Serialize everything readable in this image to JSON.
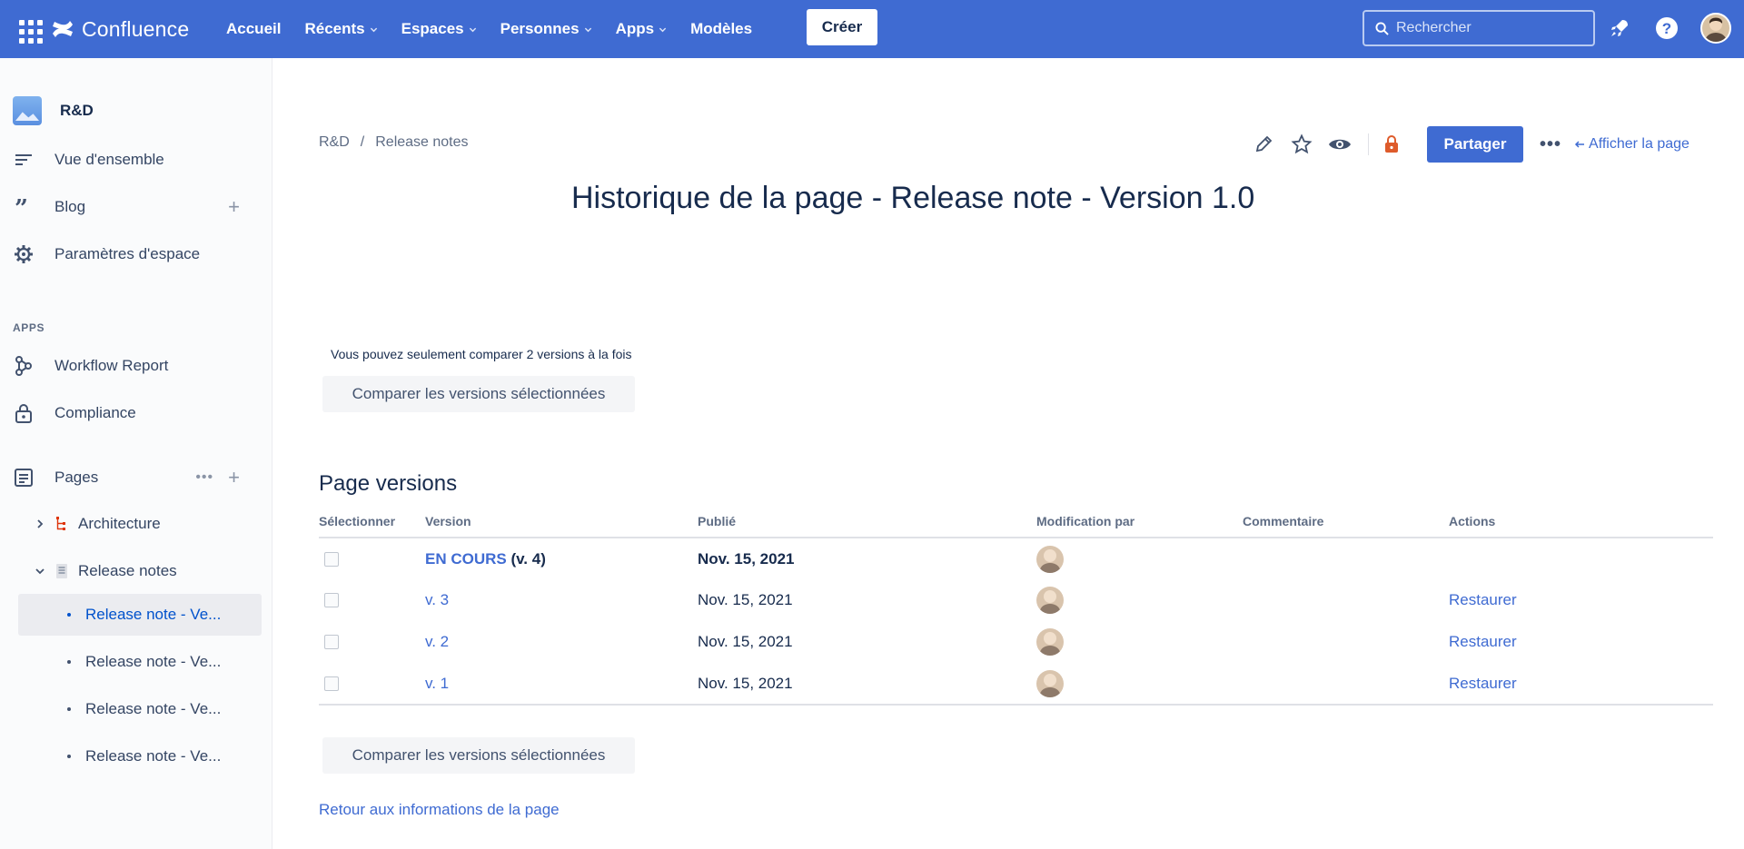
{
  "topnav": {
    "brand": "Confluence",
    "items": [
      {
        "label": "Accueil",
        "dropdown": false
      },
      {
        "label": "Récents",
        "dropdown": true
      },
      {
        "label": "Espaces",
        "dropdown": true
      },
      {
        "label": "Personnes",
        "dropdown": true
      },
      {
        "label": "Apps",
        "dropdown": true
      },
      {
        "label": "Modèles",
        "dropdown": false
      }
    ],
    "create_label": "Créer",
    "search_placeholder": "Rechercher"
  },
  "sidebar": {
    "space_name": "R&D",
    "items": [
      {
        "label": "Vue d'ensemble",
        "icon": "overview-icon"
      },
      {
        "label": "Blog",
        "icon": "quote-icon"
      },
      {
        "label": "Paramètres d'espace",
        "icon": "gear-icon"
      }
    ],
    "apps_section": "APPS",
    "apps": [
      {
        "label": "Workflow Report",
        "icon": "workflow-icon"
      },
      {
        "label": "Compliance",
        "icon": "lock-icon"
      }
    ],
    "pages_label": "Pages",
    "tree": {
      "architecture": "Architecture",
      "release_notes": "Release notes",
      "children": [
        "Release note - Ve...",
        "Release note - Ve...",
        "Release note - Ve...",
        "Release note - Ve..."
      ]
    }
  },
  "breadcrumb": [
    "R&D",
    "/",
    "Release notes"
  ],
  "actions": {
    "share_label": "Partager",
    "more_label": "•••",
    "view_page_label": "Afficher la page"
  },
  "page_title": "Historique de la page - Release note - Version 1.0",
  "compare_note": "Vous pouvez seulement comparer 2 versions à la fois",
  "compare_button": "Comparer les versions sélectionnées",
  "versions": {
    "title": "Page versions",
    "columns": [
      "Sélectionner",
      "Version",
      "Publié",
      "Modification par",
      "Commentaire",
      "Actions"
    ],
    "rows": [
      {
        "version_main": "EN COURS",
        "version_suffix": " (v. 4)",
        "published": "Nov. 15, 2021",
        "action": ""
      },
      {
        "version_main": "v. 3",
        "version_suffix": "",
        "published": "Nov. 15, 2021",
        "action": "Restaurer"
      },
      {
        "version_main": "v. 2",
        "version_suffix": "",
        "published": "Nov. 15, 2021",
        "action": "Restaurer"
      },
      {
        "version_main": "v. 1",
        "version_suffix": "",
        "published": "Nov. 15, 2021",
        "action": "Restaurer"
      }
    ]
  },
  "back_link": "Retour aux informations de la page",
  "colors": {
    "nav_background": "#3f6bd2",
    "link": "#3f6bd2",
    "text": "#172b4d",
    "restrict_lock": "#de5b2b"
  }
}
